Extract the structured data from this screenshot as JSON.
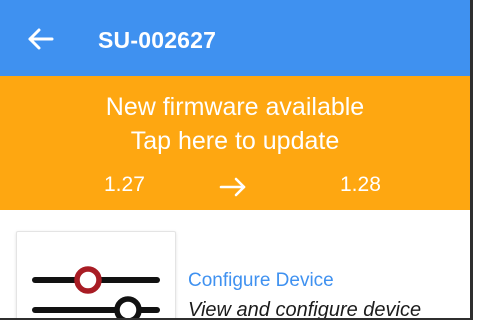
{
  "appbar": {
    "title": "SU-002627",
    "back_icon": "arrow-left-icon",
    "color": "#3f91f0"
  },
  "banner": {
    "line1": "New firmware available",
    "line2": "Tap here to update",
    "current_version": "1.27",
    "new_version": "1.28",
    "arrow_icon": "arrow-right-icon",
    "color": "#fea711"
  },
  "card": {
    "icon": "sliders-icon",
    "title": "Configure Device",
    "description": "View and configure device",
    "title_color": "#3f91f0",
    "knob_color": "#a81c24"
  }
}
